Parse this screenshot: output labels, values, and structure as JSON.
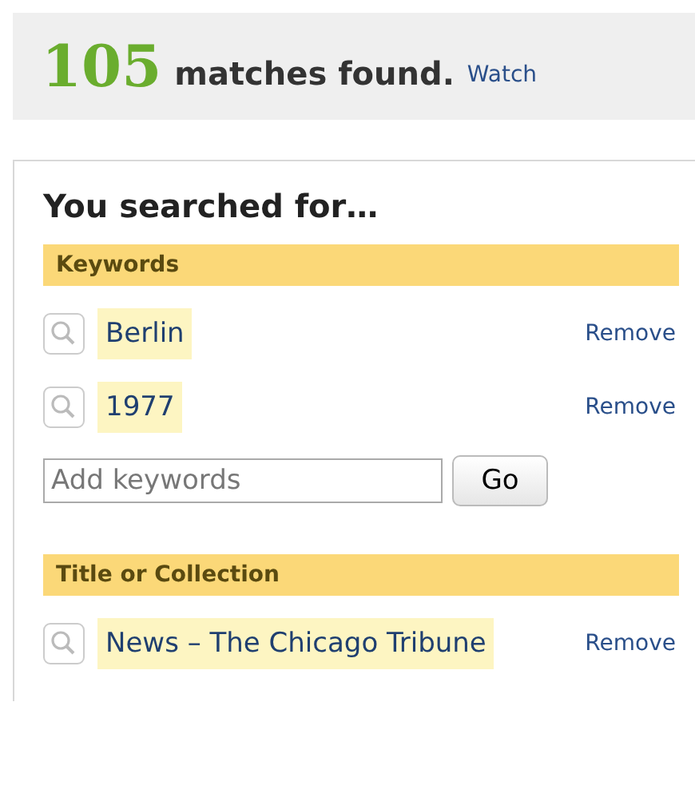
{
  "summary": {
    "count": "105",
    "text": "matches found.",
    "link": "Watch"
  },
  "panel": {
    "title": "You searched for…",
    "sections": [
      {
        "heading": "Keywords",
        "terms": [
          {
            "label": "Berlin",
            "action": "Remove"
          },
          {
            "label": "1977",
            "action": "Remove"
          }
        ],
        "input": {
          "placeholder": "Add keywords",
          "button": "Go"
        }
      },
      {
        "heading": "Title or Collection",
        "terms": [
          {
            "label": "News – The Chicago Tribune",
            "action": "Remove"
          }
        ]
      }
    ]
  }
}
